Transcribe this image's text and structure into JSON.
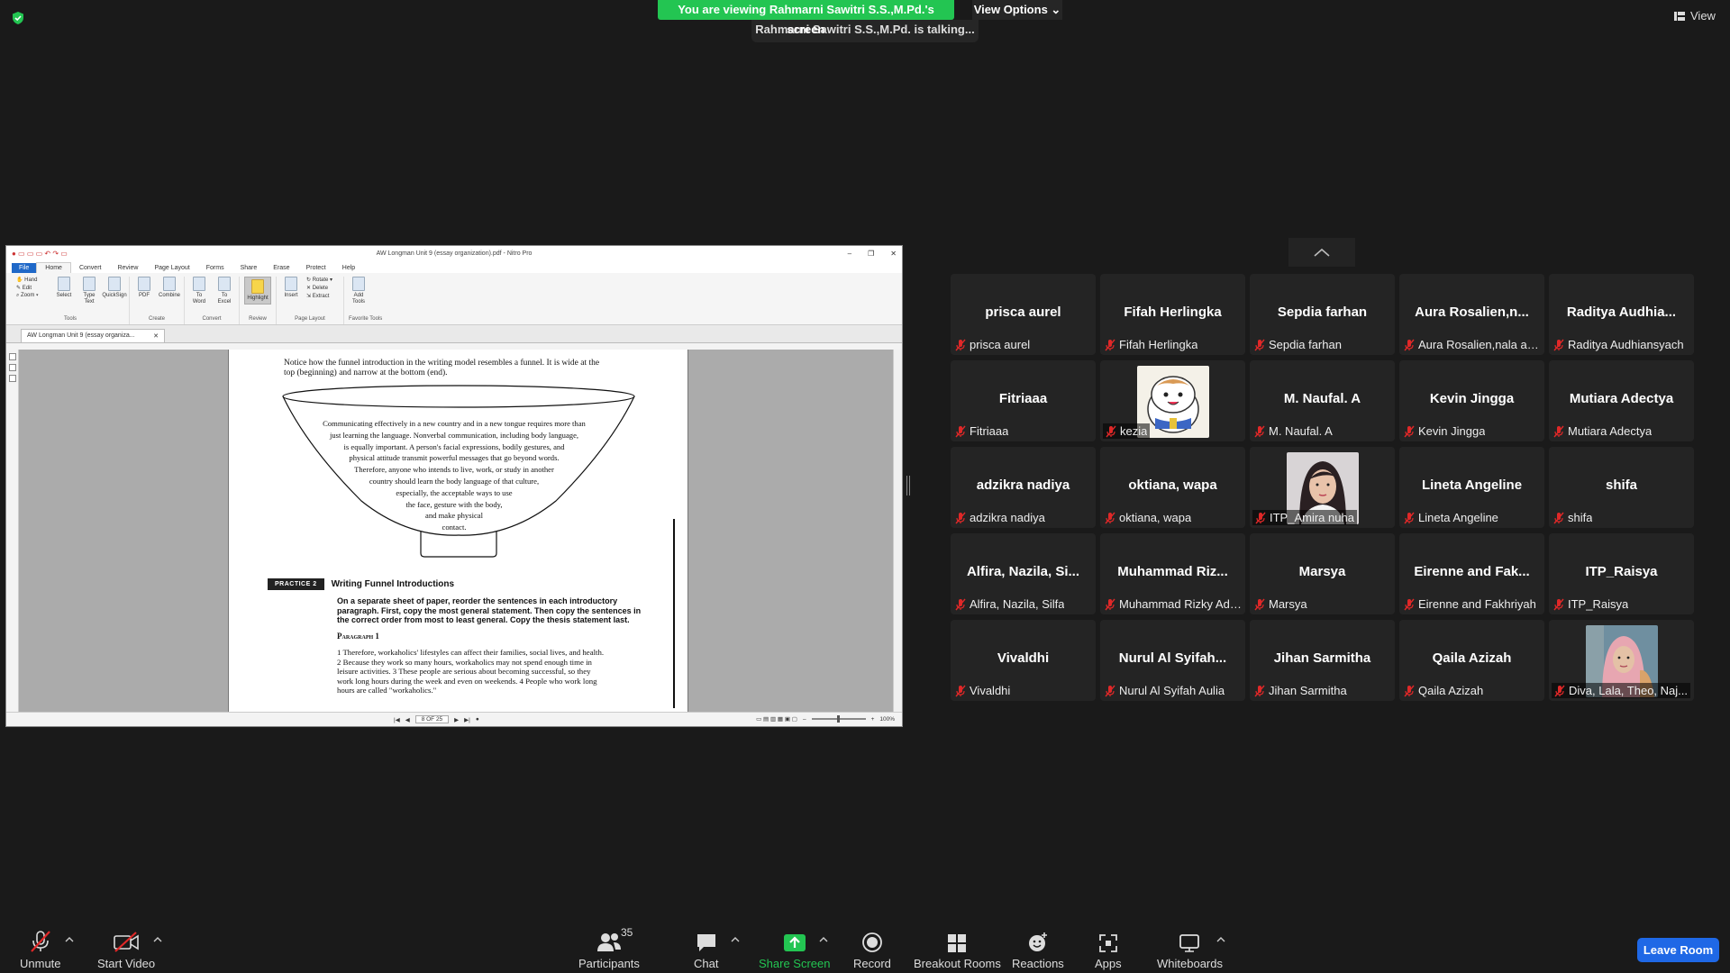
{
  "meeting": {
    "viewing_banner": "You are viewing Rahmarni Sawitri S.S.,M.Pd.'s screen",
    "talking": "Rahmarni Sawitri S.S.,M.Pd. is talking...",
    "view_options": "View Options",
    "view": "View"
  },
  "nitro": {
    "window_title": "AW Longman Unit 9 (essay organization).pdf - Nitro Pro",
    "menu": [
      "File",
      "Home",
      "Convert",
      "Review",
      "Page Layout",
      "Forms",
      "Share",
      "Erase",
      "Protect",
      "Help"
    ],
    "tools": {
      "hand": "Hand",
      "edit": "Edit",
      "zoom": "Zoom",
      "select": "Select",
      "type_text": "Type Text",
      "quicksign": "QuickSign",
      "group": "Tools"
    },
    "create": {
      "pdf": "PDF",
      "combine": "Combine",
      "group": "Create"
    },
    "convert": {
      "to_word": "To Word",
      "to_excel": "To Excel",
      "group": "Convert"
    },
    "review": {
      "highlight": "Highlight",
      "group": "Review"
    },
    "page_layout": {
      "insert": "Insert",
      "rotate": "Rotate",
      "delete": "Delete",
      "extract": "Extract",
      "group": "Page Layout"
    },
    "favorite": {
      "add_tools": "Add Tools",
      "group": "Favorite Tools"
    },
    "doc_tab": "AW Longman Unit 9 (essay organiza...",
    "page_indicator": "8 OF 25",
    "zoom_level": "100%"
  },
  "document": {
    "intro": "Notice how the funnel introduction in the writing model resembles a funnel. It is wide at the top (beginning) and narrow at the bottom (end).",
    "funnel_lines": [
      "Communicating effectively in a new country and in a new tongue requires more than",
      "just learning the language. Nonverbal communication, including body language,",
      "is equally important. A person's facial expressions, bodily gestures, and",
      "physical attitude transmit powerful messages that go beyond words.",
      "Therefore, anyone who intends to live, work, or study in another",
      "country should learn the body language of that culture,",
      "especially, the acceptable ways to use",
      "the face, gesture with the body,",
      "and make physical",
      "contact."
    ],
    "practice_badge": "PRACTICE 2",
    "practice_title": "Writing Funnel Introductions",
    "practice_instructions": "On a separate sheet of paper, reorder the sentences in each introductory paragraph. First, copy the most general statement. Then copy the sentences in the correct order from most to least general. Copy the thesis statement last.",
    "paragraph_heading": "Paragraph 1",
    "paragraph_text": "1 Therefore, workaholics' lifestyles can affect their families, social lives, and health. 2 Because they work so many hours, workaholics may not spend enough time in leisure activities. 3 These people are serious about becoming successful, so they work long hours during the week and even on weekends. 4 People who work long hours are called \"workaholics.\""
  },
  "participants": [
    {
      "big": "prisca aurel",
      "label": "prisca aurel"
    },
    {
      "big": "Fifah Herlingka",
      "label": "Fifah Herlingka"
    },
    {
      "big": "Sepdia farhan",
      "label": "Sepdia farhan"
    },
    {
      "big": "Aura  Rosalien,n...",
      "label": "Aura Rosalien,nala an..."
    },
    {
      "big": "Raditya  Audhia...",
      "label": "Raditya Audhiansyach"
    },
    {
      "big": "Fitriaaa",
      "label": "Fitriaaa"
    },
    {
      "big": "",
      "label": "kezia",
      "avatar": "hamster"
    },
    {
      "big": "M. Naufal. A",
      "label": "M. Naufal. A"
    },
    {
      "big": "Kevin Jingga",
      "label": "Kevin Jingga"
    },
    {
      "big": "Mutiara Adectya",
      "label": "Mutiara Adectya"
    },
    {
      "big": "adzikra nadiya",
      "label": "adzikra nadiya"
    },
    {
      "big": "oktiana, wapa",
      "label": "oktiana, wapa"
    },
    {
      "big": "",
      "label": "ITP_Amira nuha",
      "avatar": "woman"
    },
    {
      "big": "Lineta Angeline",
      "label": "Lineta Angeline"
    },
    {
      "big": "shifa",
      "label": "shifa"
    },
    {
      "big": "Alfira,  Nazila,  Si...",
      "label": "Alfira, Nazila, Silfa"
    },
    {
      "big": "Muhammad  Riz...",
      "label": "Muhammad Rizky Adi..."
    },
    {
      "big": "Marsya",
      "label": "Marsya"
    },
    {
      "big": "Eirenne  and  Fak...",
      "label": "Eirenne and Fakhriyah"
    },
    {
      "big": "ITP_Raisya",
      "label": "ITP_Raisya"
    },
    {
      "big": "Vivaldhi",
      "label": "Vivaldhi"
    },
    {
      "big": "Nurul  Al  Syifah...",
      "label": "Nurul Al Syifah Aulia"
    },
    {
      "big": "Jihan Sarmitha",
      "label": "Jihan Sarmitha"
    },
    {
      "big": "Qaila Azizah",
      "label": "Qaila Azizah"
    },
    {
      "big": "",
      "label": "Diva, Lala, Theo, Naj...",
      "avatar": "hijab"
    }
  ],
  "toolbar": {
    "unmute": "Unmute",
    "start_video": "Start Video",
    "participants": "Participants",
    "participants_count": "35",
    "chat": "Chat",
    "share_screen": "Share Screen",
    "record": "Record",
    "breakout": "Breakout Rooms",
    "reactions": "Reactions",
    "apps": "Apps",
    "whiteboards": "Whiteboards",
    "leave": "Leave Room"
  },
  "colors": {
    "banner_green": "#23c552",
    "share_green": "#23c552",
    "leave_blue": "#1f68e6",
    "mute_red": "#e02828"
  }
}
